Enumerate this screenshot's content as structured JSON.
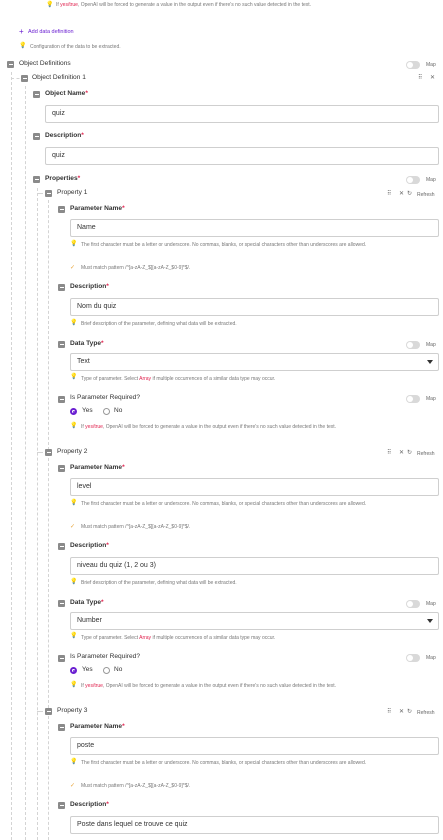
{
  "hints": {
    "required_prefix": "If",
    "required_word": "yes/true",
    "required_suffix": ", OpenAI will be forced to generate a value in the output even if there's no such value detected in the text.",
    "char_rule": "The first character must be a letter or underscore. No commas, blanks, or special characters other than underscores are allowed.",
    "pattern": "Must match pattern /^[a-zA-Z_$][a-zA-Z_$0-9]*$/.",
    "description_hint": "Brief description of the parameter, defining what data will be extracted.",
    "type_prefix": "Type of parameter. Select",
    "type_word": "Array",
    "type_suffix": "if multiple occurrences of a similar data type may occur."
  },
  "add_data_definition": "Add data definition",
  "config_hint": "Configuration of the data to be extracted.",
  "object_definitions": {
    "label": "Object Definitions",
    "map": "Map",
    "item_label": "Object Definition 1",
    "object_name_label": "Object Name",
    "object_name_value": "quiz",
    "description_label": "Description",
    "description_value": "quiz",
    "properties_label": "Properties",
    "properties_map": "Map"
  },
  "common": {
    "required_star": "*",
    "param_name_label": "Parameter Name",
    "description_label": "Description",
    "data_type_label": "Data Type",
    "is_required_label": "Is Parameter Required?",
    "yes": "Yes",
    "no": "No",
    "map": "Map",
    "refresh": "Refresh",
    "drag_icon": "⠿",
    "close_icon": "✕",
    "refresh_icon": "↻"
  },
  "properties": [
    {
      "title": "Property 1",
      "name": "Name",
      "description": "Nom du quiz",
      "type": "Text"
    },
    {
      "title": "Property 2",
      "name": "level",
      "description": "niveau du quiz (1, 2 ou 3)",
      "type": "Number"
    },
    {
      "title": "Property 3",
      "name": "poste",
      "description": "Poste dans lequel ce trouve ce quiz"
    }
  ],
  "colors": {
    "accent": "#6a1fd1",
    "required": "#e0224e",
    "hint_icon": "#f0b400"
  }
}
